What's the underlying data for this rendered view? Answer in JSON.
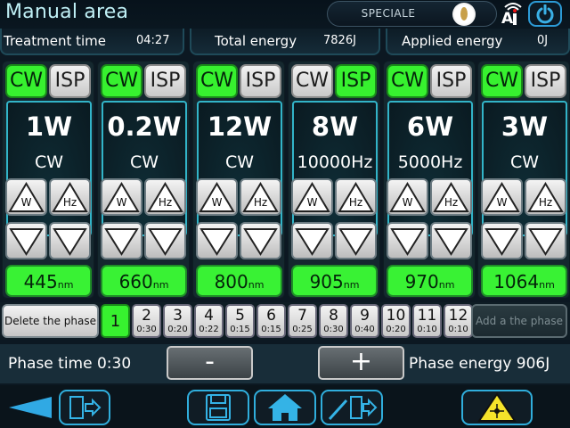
{
  "app": {
    "title": "Manual area",
    "mode_label": "SPECIALE"
  },
  "top_icons": {
    "ai": "ai-wifi-icon",
    "power": "power-icon",
    "logo": "brand-logo"
  },
  "info": {
    "treatment_time_label": "Treatment time",
    "treatment_time": "04:27",
    "total_energy_label": "Total energy",
    "total_energy": "7826J",
    "applied_energy_label": "Applied energy",
    "applied_energy": "0J"
  },
  "channels": [
    {
      "cw": "CW",
      "isp": "ISP",
      "active": "cw",
      "power": "1W",
      "mode": "CW",
      "w": "W",
      "hz": "Hz",
      "wavelength": "445",
      "unit": "nm"
    },
    {
      "cw": "CW",
      "isp": "ISP",
      "active": "cw",
      "power": "0.2W",
      "mode": "CW",
      "w": "W",
      "hz": "Hz",
      "wavelength": "660",
      "unit": "nm"
    },
    {
      "cw": "CW",
      "isp": "ISP",
      "active": "cw",
      "power": "12W",
      "mode": "CW",
      "w": "W",
      "hz": "Hz",
      "wavelength": "800",
      "unit": "nm"
    },
    {
      "cw": "CW",
      "isp": "ISP",
      "active": "isp",
      "power": "8W",
      "mode": "10000Hz",
      "w": "W",
      "hz": "Hz",
      "wavelength": "905",
      "unit": "nm"
    },
    {
      "cw": "CW",
      "isp": "ISP",
      "active": "cw",
      "power": "6W",
      "mode": "5000Hz",
      "w": "W",
      "hz": "Hz",
      "wavelength": "970",
      "unit": "nm"
    },
    {
      "cw": "CW",
      "isp": "ISP",
      "active": "cw",
      "power": "3W",
      "mode": "CW",
      "w": "W",
      "hz": "Hz",
      "wavelength": "1064",
      "unit": "nm"
    }
  ],
  "phases": {
    "delete_label": "Delete the phase",
    "add_label": "Add a the phase",
    "active": "1",
    "items": [
      {
        "num": "1",
        "time": ""
      },
      {
        "num": "2",
        "time": "0:30"
      },
      {
        "num": "3",
        "time": "0:20"
      },
      {
        "num": "4",
        "time": "0:22"
      },
      {
        "num": "5",
        "time": "0:15"
      },
      {
        "num": "6",
        "time": "0:15"
      },
      {
        "num": "7",
        "time": "0:25"
      },
      {
        "num": "8",
        "time": "0:30"
      },
      {
        "num": "9",
        "time": "0:40"
      },
      {
        "num": "10",
        "time": "0:20"
      },
      {
        "num": "11",
        "time": "0:10"
      },
      {
        "num": "12",
        "time": "0:10"
      }
    ]
  },
  "phase_time": {
    "label": "Phase time 0:30",
    "minus": "-",
    "plus": "+",
    "energy_label": "Phase energy 906J"
  },
  "nav": {
    "back": "back-arrow-icon",
    "exit": "exit-door-icon",
    "save": "save-floppy-icon",
    "home": "home-icon",
    "edit_exit": "edit-exit-icon",
    "laser": "laser-warning-icon"
  },
  "colors": {
    "active_green": "#37f12f",
    "accent_cyan": "#32b4c8",
    "nav_blue": "#30aedc"
  }
}
